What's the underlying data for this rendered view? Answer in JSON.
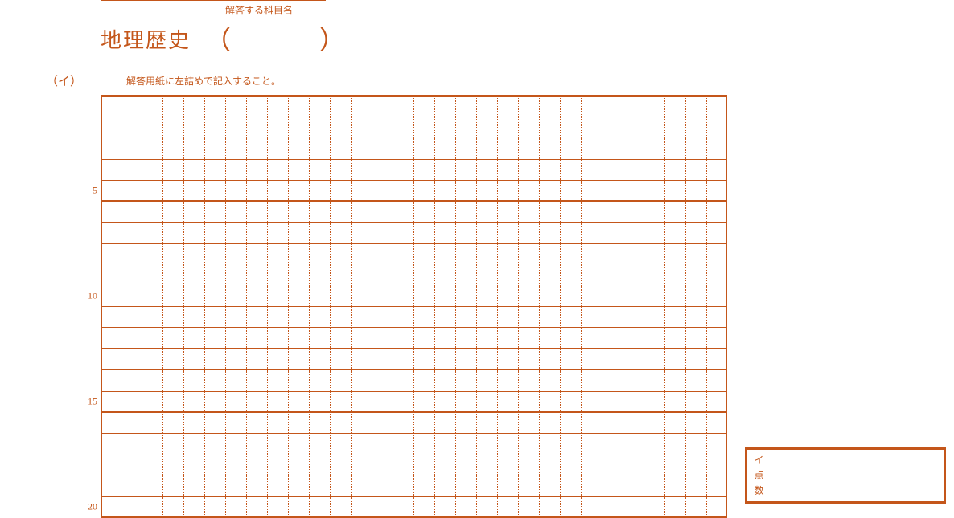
{
  "header": {
    "subject_label_small": "解答する科目名",
    "subject_name": "地理歴史"
  },
  "question": {
    "label": "（イ）",
    "instruction": "解答用紙に左詰めで記入すること。"
  },
  "grid": {
    "rows": 20,
    "cols": 30,
    "heavy_every": 5,
    "numbered_rows": [
      5,
      10,
      15,
      20
    ]
  },
  "score_box": {
    "sub_label": "イ",
    "char1": "点",
    "char2": "数"
  }
}
